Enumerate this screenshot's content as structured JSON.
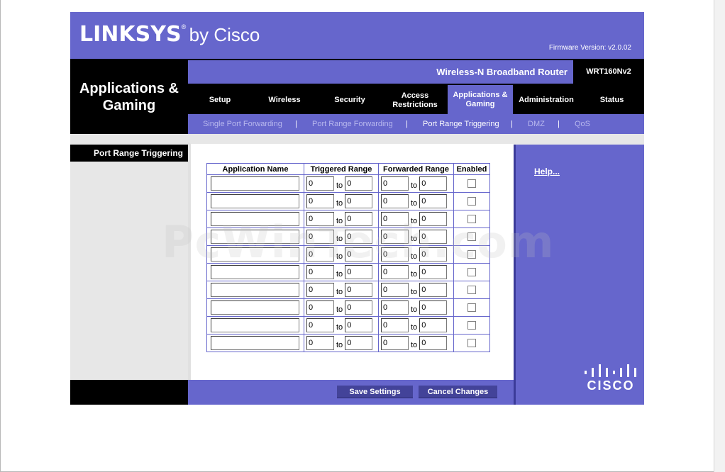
{
  "header": {
    "brand": "LINKSYS",
    "brand_suffix": "by Cisco",
    "firmware": "Firmware Version: v2.0.02",
    "product_name": "Wireless-N Broadband Router",
    "model": "WRT160Nv2",
    "section_title": "Applications & Gaming",
    "banner_color": "#6666cc"
  },
  "main_tabs": [
    {
      "label": "Setup"
    },
    {
      "label": "Wireless"
    },
    {
      "label": "Security"
    },
    {
      "label": "Access Restrictions"
    },
    {
      "label": "Applications & Gaming",
      "active": true
    },
    {
      "label": "Administration"
    },
    {
      "label": "Status"
    }
  ],
  "sub_tabs": [
    {
      "label": "Single Port Forwarding"
    },
    {
      "label": "Port Range Forwarding"
    },
    {
      "label": "Port Range Triggering",
      "active": true
    },
    {
      "label": "DMZ"
    },
    {
      "label": "QoS"
    }
  ],
  "sidebar": {
    "heading": "Port Range Triggering"
  },
  "table": {
    "headers": [
      "Application Name",
      "Triggered Range",
      "Forwarded Range",
      "Enabled"
    ],
    "to_label": "to",
    "rows": [
      {
        "app": "",
        "t_start": "0",
        "t_end": "0",
        "f_start": "0",
        "f_end": "0",
        "enabled": false
      },
      {
        "app": "",
        "t_start": "0",
        "t_end": "0",
        "f_start": "0",
        "f_end": "0",
        "enabled": false
      },
      {
        "app": "",
        "t_start": "0",
        "t_end": "0",
        "f_start": "0",
        "f_end": "0",
        "enabled": false
      },
      {
        "app": "",
        "t_start": "0",
        "t_end": "0",
        "f_start": "0",
        "f_end": "0",
        "enabled": false
      },
      {
        "app": "",
        "t_start": "0",
        "t_end": "0",
        "f_start": "0",
        "f_end": "0",
        "enabled": false
      },
      {
        "app": "",
        "t_start": "0",
        "t_end": "0",
        "f_start": "0",
        "f_end": "0",
        "enabled": false
      },
      {
        "app": "",
        "t_start": "0",
        "t_end": "0",
        "f_start": "0",
        "f_end": "0",
        "enabled": false
      },
      {
        "app": "",
        "t_start": "0",
        "t_end": "0",
        "f_start": "0",
        "f_end": "0",
        "enabled": false
      },
      {
        "app": "",
        "t_start": "0",
        "t_end": "0",
        "f_start": "0",
        "f_end": "0",
        "enabled": false
      },
      {
        "app": "",
        "t_start": "0",
        "t_end": "0",
        "f_start": "0",
        "f_end": "0",
        "enabled": false
      }
    ]
  },
  "help": {
    "label": "Help..."
  },
  "cisco": {
    "label": "CISCO",
    "icon": "cisco-bars-icon"
  },
  "actions": {
    "save": "Save Settings",
    "cancel": "Cancel Changes"
  },
  "watermark": "PcWinTech.com"
}
